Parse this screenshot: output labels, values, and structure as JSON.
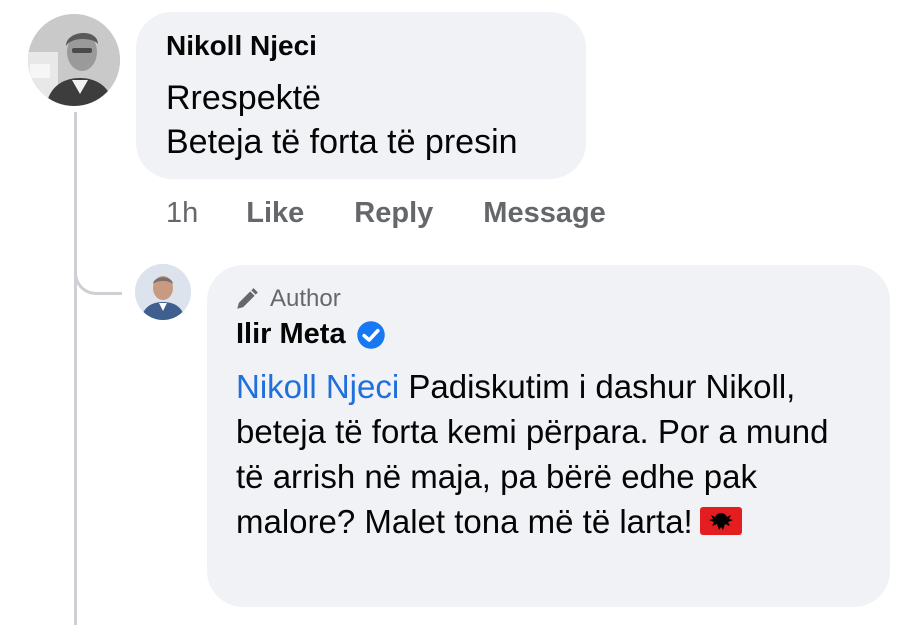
{
  "comment": {
    "author": "Nikoll Njeci",
    "lines": [
      "Rrespektë",
      "Beteja të forta të presin"
    ],
    "time": "1h",
    "actions": {
      "like": "Like",
      "reply": "Reply",
      "message": "Message"
    }
  },
  "reply": {
    "badge": "Author",
    "author": "Ilir Meta",
    "mention": "Nikoll Njeci",
    "text": " Padiskutim i dashur Nikoll, beteja të forta kemi përpara. Por a mund të arrish në maja, pa bërë edhe pak malore? Malet tona më të larta!",
    "icons": {
      "badge": "pencil-icon",
      "verified": "verified-check-icon",
      "flag": "albania-flag-emoji"
    }
  },
  "colors": {
    "bubble": "#f0f2f5",
    "mention": "#216fdb",
    "verified": "#1877f2",
    "muted": "#65676b",
    "thread": "#ced0d4"
  }
}
